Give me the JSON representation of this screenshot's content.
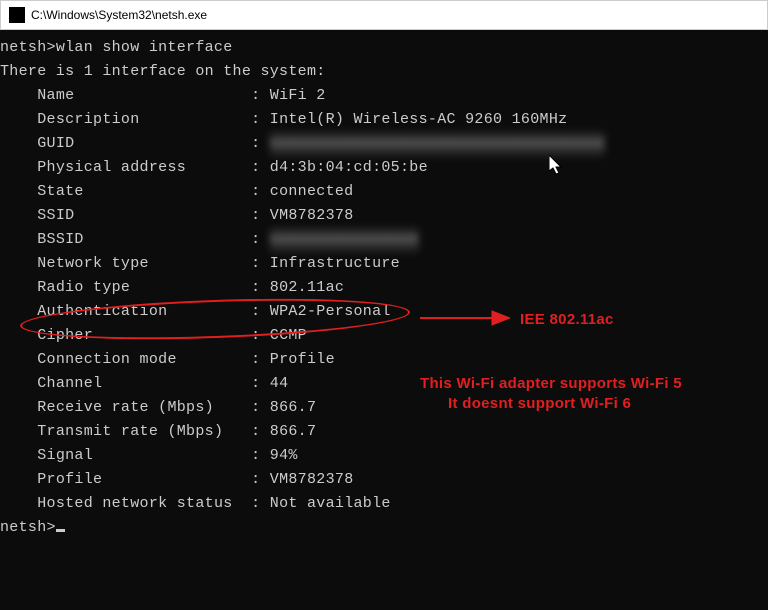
{
  "window": {
    "title": "C:\\Windows\\System32\\netsh.exe"
  },
  "terminal": {
    "prompt1": "netsh>",
    "command": "wlan show interface",
    "blank": "",
    "header": "There is 1 interface on the system:",
    "labels": {
      "name": "Name",
      "description": "Description",
      "guid": "GUID",
      "physical_address": "Physical address",
      "state": "State",
      "ssid": "SSID",
      "bssid": "BSSID",
      "network_type": "Network type",
      "radio_type": "Radio type",
      "authentication": "Authentication",
      "cipher": "Cipher",
      "connection_mode": "Connection mode",
      "channel": "Channel",
      "receive_rate": "Receive rate (Mbps)",
      "transmit_rate": "Transmit rate (Mbps)",
      "signal": "Signal",
      "profile": "Profile",
      "hosted_network": "Hosted network status"
    },
    "values": {
      "name": "WiFi 2",
      "description": "Intel(R) Wireless-AC 9260 160MHz",
      "guid": "xxxxxxxxxxxxxxxxxxxxxxxxxxxxxxxxxxxx",
      "physical_address": "d4:3b:04:cd:05:be",
      "state": "connected",
      "ssid": "VM8782378",
      "bssid": "xxxxxxxxxxxxxxxx",
      "network_type": "Infrastructure",
      "radio_type": "802.11ac",
      "authentication": "WPA2-Personal",
      "cipher": "CCMP",
      "connection_mode": "Profile",
      "channel": "44",
      "receive_rate": "866.7",
      "transmit_rate": "866.7",
      "signal": "94%",
      "profile": "VM8782378",
      "hosted_network": "Not available"
    },
    "prompt2": "netsh>"
  },
  "annotations": {
    "label1": "IEE 802.11ac",
    "label2": "This Wi-Fi adapter supports Wi-Fi 5",
    "label3": "It doesnt support Wi-Fi 6"
  }
}
